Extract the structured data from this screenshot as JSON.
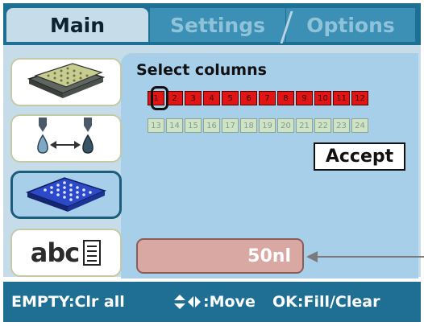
{
  "tabs": [
    {
      "label": "Main",
      "active": true
    },
    {
      "label": "Settings",
      "active": false
    },
    {
      "label": "Options",
      "active": false
    }
  ],
  "sidebar": {
    "items": [
      {
        "name": "plates-icon",
        "active": false
      },
      {
        "name": "dispense-icon",
        "active": false
      },
      {
        "name": "plate-96-icon",
        "active": true
      },
      {
        "name": "abc-label-icon",
        "active": false,
        "text": "abc"
      }
    ]
  },
  "content": {
    "title": "Select columns",
    "columns_row1": [
      "1",
      "2",
      "3",
      "4",
      "5",
      "6",
      "7",
      "8",
      "9",
      "10",
      "11",
      "12"
    ],
    "columns_row2": [
      "13",
      "14",
      "15",
      "16",
      "17",
      "18",
      "19",
      "20",
      "21",
      "22",
      "23",
      "24"
    ],
    "selected_columns": [
      "1",
      "2",
      "3",
      "4",
      "5",
      "6",
      "7",
      "8",
      "9",
      "10",
      "11",
      "12"
    ],
    "cursor_column": "1",
    "accept_label": "Accept",
    "volume": "50nl"
  },
  "footer": {
    "empty": "EMPTY:Clr all",
    "move": ":Move",
    "ok": "OK:Fill/Clear"
  },
  "colors": {
    "header": "#1e6f94",
    "selected": "#e21515",
    "unselected": "#cde4c6",
    "content_bg": "#a7cfe9"
  }
}
